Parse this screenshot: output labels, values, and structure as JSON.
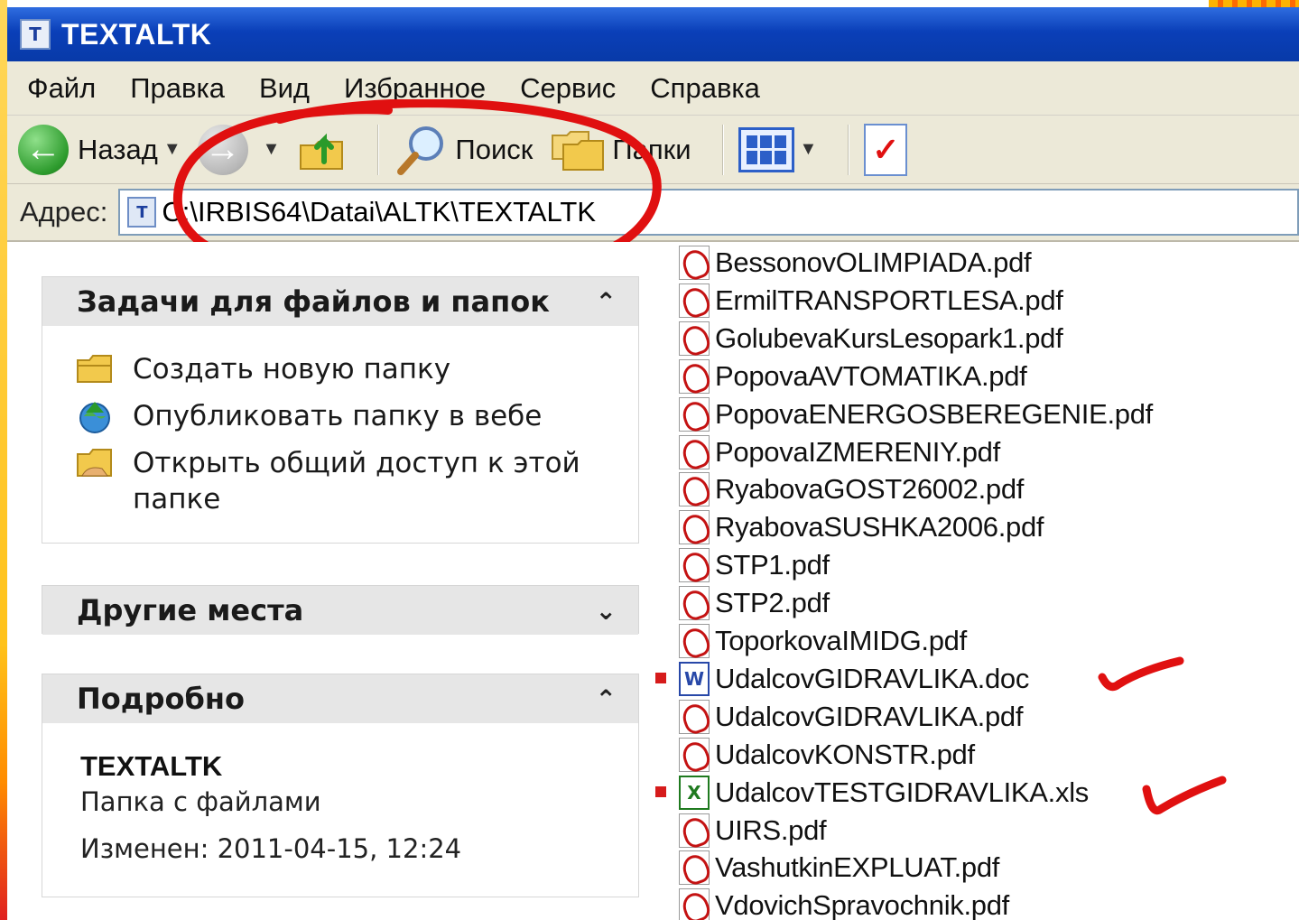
{
  "window": {
    "title": "TEXTALTK"
  },
  "menu": {
    "items": [
      "Файл",
      "Правка",
      "Вид",
      "Избранное",
      "Сервис",
      "Справка"
    ]
  },
  "toolbar": {
    "back_label": "Назад",
    "search_label": "Поиск",
    "folders_label": "Папки"
  },
  "address": {
    "label": "Адрес:",
    "path": "C:\\IRBIS64\\Datai\\ALTK\\TEXTALTK"
  },
  "tasks_panel": {
    "title": "Задачи для файлов и папок",
    "items": [
      {
        "label": "Создать новую папку",
        "icon": "new-folder-icon"
      },
      {
        "label": "Опубликовать папку в вебе",
        "icon": "publish-web-icon"
      },
      {
        "label": "Открыть общий доступ к этой папке",
        "icon": "share-folder-icon"
      }
    ]
  },
  "other_places_panel": {
    "title": "Другие места"
  },
  "details_panel": {
    "title": "Подробно",
    "name": "TEXTALTK",
    "type": "Папка с файлами",
    "modified": "Изменен: 2011-04-15, 12:24"
  },
  "files": [
    {
      "name": "BessonovOLIMPIADA.pdf",
      "type": "pdf",
      "selected": false
    },
    {
      "name": "ErmilTRANSPORTLESA.pdf",
      "type": "pdf",
      "selected": false
    },
    {
      "name": "GolubevaKursLesopark1.pdf",
      "type": "pdf",
      "selected": false
    },
    {
      "name": "PopovaAVTOMATIKA.pdf",
      "type": "pdf",
      "selected": false
    },
    {
      "name": "PopovaENERGOSBEREGENIE.pdf",
      "type": "pdf",
      "selected": false
    },
    {
      "name": "PopovaIZMERENIY.pdf",
      "type": "pdf",
      "selected": false
    },
    {
      "name": "RyabovaGOST26002.pdf",
      "type": "pdf",
      "selected": false
    },
    {
      "name": "RyabovaSUSHKA2006.pdf",
      "type": "pdf",
      "selected": false
    },
    {
      "name": "STP1.pdf",
      "type": "pdf",
      "selected": false
    },
    {
      "name": "STP2.pdf",
      "type": "pdf",
      "selected": false
    },
    {
      "name": "ToporkovaIMIDG.pdf",
      "type": "pdf",
      "selected": false
    },
    {
      "name": "UdalcovGIDRAVLIKA.doc",
      "type": "doc",
      "selected": true
    },
    {
      "name": "UdalcovGIDRAVLIKA.pdf",
      "type": "pdf",
      "selected": false
    },
    {
      "name": "UdalcovKONSTR.pdf",
      "type": "pdf",
      "selected": false
    },
    {
      "name": "UdalcovTESTGIDRAVLIKA.xls",
      "type": "xls",
      "selected": true
    },
    {
      "name": "UIRS.pdf",
      "type": "pdf",
      "selected": false
    },
    {
      "name": "VashutkinEXPLUAT.pdf",
      "type": "pdf",
      "selected": false
    },
    {
      "name": "VdovichSpravochnik.pdf",
      "type": "pdf",
      "selected": false
    }
  ],
  "colors": {
    "titlebar": "#0a3fb8",
    "chrome": "#ece9d8",
    "annotation_red": "#e01010"
  }
}
